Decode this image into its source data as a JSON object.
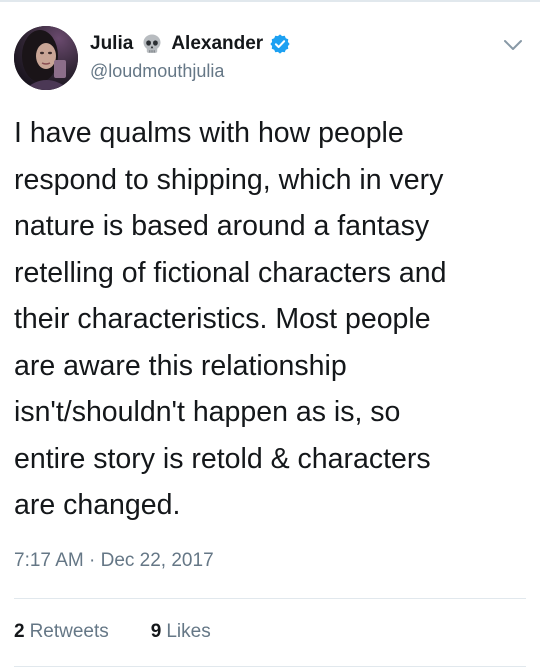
{
  "tweet": {
    "author": {
      "first_name": "Julia",
      "last_name": "Alexander",
      "handle": "@loudmouthjulia",
      "name_emoji": "skull-icon",
      "verified": true
    },
    "text": "I have qualms with how people\nrespond to shipping, which in very\nnature is based around a fantasy\nretelling of fictional characters and\ntheir characteristics. Most people\nare aware this relationship\nisn't/shouldn't happen as is, so\nentire story is retold & characters\nare changed.",
    "time": "7:17 AM",
    "separator": " · ",
    "date": "Dec 22, 2017",
    "stats": {
      "retweets_count": "2",
      "retweets_label": "Retweets",
      "likes_count": "9",
      "likes_label": "Likes"
    }
  },
  "colors": {
    "text": "#14171a",
    "secondary": "#657786",
    "verified": "#1da1f2",
    "divider": "#e1e8ed"
  }
}
